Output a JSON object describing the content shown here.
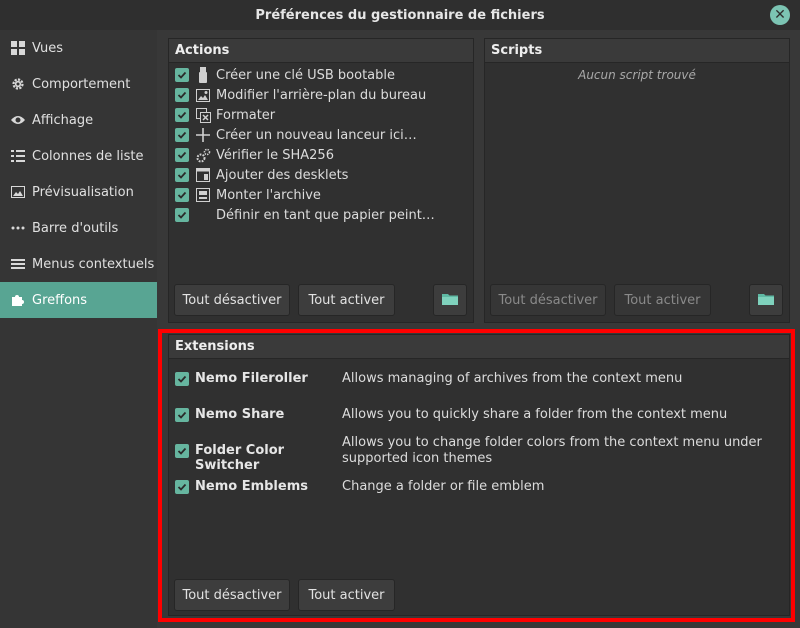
{
  "window": {
    "title": "Préférences du gestionnaire de fichiers"
  },
  "sidebar": {
    "items": [
      {
        "label": "Vues",
        "icon": "grid-icon"
      },
      {
        "label": "Comportement",
        "icon": "gear-icon"
      },
      {
        "label": "Affichage",
        "icon": "eye-icon"
      },
      {
        "label": "Colonnes de liste",
        "icon": "list-icon"
      },
      {
        "label": "Prévisualisation",
        "icon": "image-icon"
      },
      {
        "label": "Barre d'outils",
        "icon": "dots-icon"
      },
      {
        "label": "Menus contextuels",
        "icon": "menu-icon"
      },
      {
        "label": "Greffons",
        "icon": "puzzle-icon"
      }
    ],
    "active_index": 7
  },
  "actions": {
    "title": "Actions",
    "items": [
      {
        "label": "Créer une clé USB bootable",
        "icon": "usb-icon",
        "checked": true
      },
      {
        "label": "Modifier l'arrière-plan du bureau",
        "icon": "wallpaper-icon",
        "checked": true
      },
      {
        "label": "Formater",
        "icon": "format-icon",
        "checked": true
      },
      {
        "label": "Créer un nouveau lanceur ici…",
        "icon": "plus-icon",
        "checked": true
      },
      {
        "label": "Vérifier le SHA256",
        "icon": "cog-icon",
        "checked": true
      },
      {
        "label": "Ajouter des desklets",
        "icon": "desklet-icon",
        "checked": true
      },
      {
        "label": "Monter l'archive",
        "icon": "archive-icon",
        "checked": true
      },
      {
        "label": "Définir en tant que papier peint…",
        "icon": "",
        "checked": true
      }
    ],
    "disable_all": "Tout désactiver",
    "enable_all": "Tout activer"
  },
  "scripts": {
    "title": "Scripts",
    "empty": "Aucun script trouvé",
    "disable_all": "Tout désactiver",
    "enable_all": "Tout activer"
  },
  "extensions": {
    "title": "Extensions",
    "items": [
      {
        "name": "Nemo Fileroller",
        "desc": "Allows managing of archives from the context menu",
        "checked": true
      },
      {
        "name": "Nemo Share",
        "desc": "Allows you to quickly share a folder from the context menu",
        "checked": true
      },
      {
        "name": "Folder Color Switcher",
        "desc": "Allows you to change folder colors from the context menu under supported icon themes",
        "checked": true
      },
      {
        "name": "Nemo Emblems",
        "desc": "Change a folder or file emblem",
        "checked": true
      }
    ],
    "disable_all": "Tout désactiver",
    "enable_all": "Tout activer"
  },
  "colors": {
    "accent": "#58a593",
    "check": "#66b59f",
    "highlight": "#ff0000"
  }
}
